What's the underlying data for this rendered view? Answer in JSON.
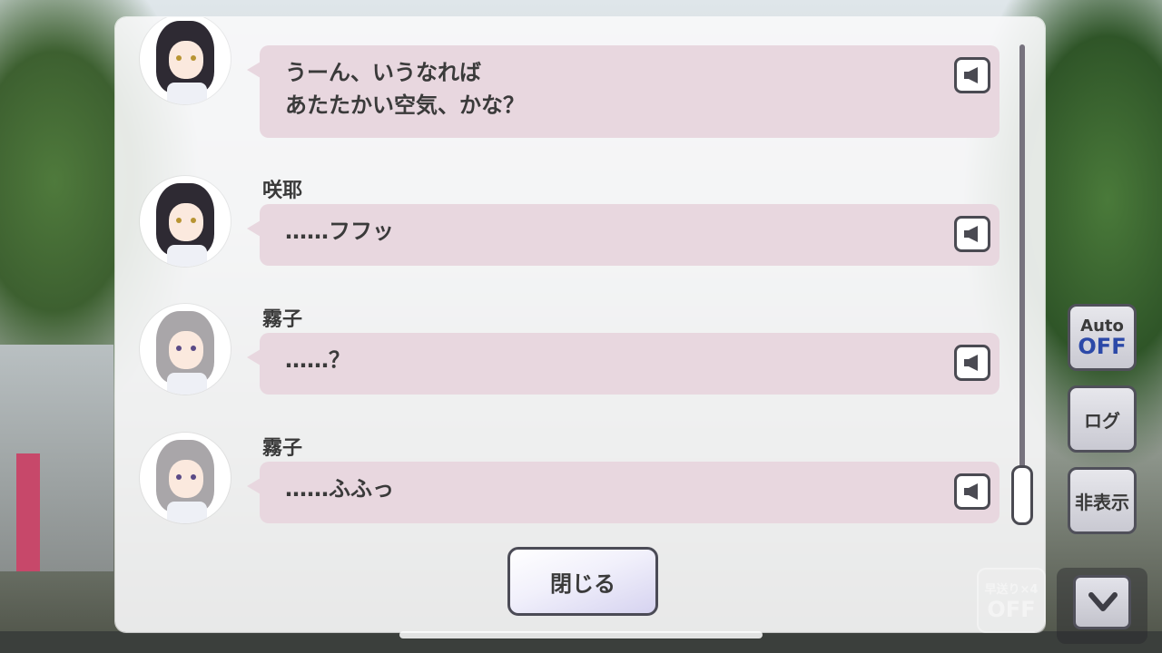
{
  "log_entries": [
    {
      "speaker": "",
      "avatar": "dark-hair-girl",
      "text_lines": [
        "うーん、いうなれば",
        "あたたかい空気、かな？"
      ]
    },
    {
      "speaker": "咲耶",
      "avatar": "dark-hair-girl",
      "text_lines": [
        "……フフッ"
      ]
    },
    {
      "speaker": "霧子",
      "avatar": "gray-hair-girl",
      "text_lines": [
        "……？"
      ]
    },
    {
      "speaker": "霧子",
      "avatar": "gray-hair-girl",
      "text_lines": [
        "……ふふっ"
      ]
    }
  ],
  "buttons": {
    "close": "閉じる",
    "auto_top": "Auto",
    "auto_bottom": "OFF",
    "log": "ログ",
    "hide": "非表示",
    "fast_forward_top": "早送り×4",
    "fast_forward_bottom": "OFF"
  },
  "icons": {
    "voice": "speaker-icon",
    "down": "chevron-down-icon"
  },
  "colors": {
    "bubble": "#e8d7df",
    "auto_off": "#2c49a8"
  }
}
